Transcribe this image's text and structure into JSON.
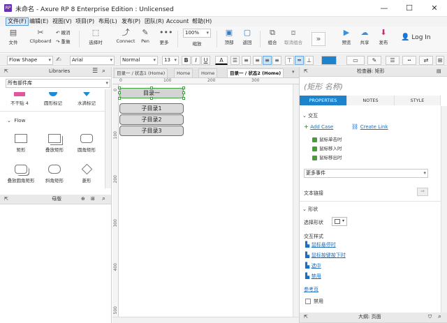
{
  "window": {
    "title": "未命名 - Axure RP 8 Enterprise Edition : Unlicensed",
    "app_icon_text": "RP",
    "minimize": "—",
    "maximize": "☐",
    "close": "✕"
  },
  "menus": [
    "文件(F)",
    "编辑(E)",
    "视图(V)",
    "项目(P)",
    "布局(L)",
    "发布(P)",
    "团队(R)",
    "Account",
    "帮助(H)"
  ],
  "toolbar": {
    "file": "文件",
    "clipboard": "Clipboard",
    "undo": "撤消",
    "redo": "重做",
    "select": "选择时",
    "connect": "Connect",
    "pen": "Pen",
    "more": "更多",
    "zoom_value": "100%",
    "zoom_label": "缩放",
    "top": "顶部",
    "back": "返回",
    "group": "组合",
    "ungroup": "取消组合",
    "preview": "预览",
    "share": "共享",
    "publish": "发布",
    "login": "Log In"
  },
  "format": {
    "style": "Flow Shape",
    "font": "Arial",
    "weight": "Normal",
    "size": "13",
    "bold": "B",
    "italic": "I",
    "underline": "U",
    "fontcolor": "A"
  },
  "left": {
    "libraries_title": "Libraries",
    "library_select": "所有部件库",
    "top_items": [
      "不干贴 4",
      "圆形标记",
      "水滴标记"
    ],
    "flow_section": "Flow",
    "flow_items": [
      "矩形",
      "叠放矩形",
      "圆角矩形",
      "叠放圆角矩形",
      "斜角矩形",
      "菱形"
    ],
    "masters_title": "母版"
  },
  "canvas": {
    "tabs": [
      "目录一 / 状态1 (Home)",
      "Home",
      "Home",
      "目录一 / 状态2 (Home)"
    ],
    "ruler_h": [
      "0",
      "100",
      "200",
      "300"
    ],
    "ruler_v": [
      "0",
      "100",
      "200",
      "300",
      "400",
      "500"
    ],
    "items": [
      "目录一",
      "子目录1",
      "子目录2",
      "子目录3"
    ]
  },
  "right": {
    "inspector_title": "检查器: 矩形",
    "shape_name_placeholder": "(矩形 名称)",
    "tabs": [
      "PROPERTIES",
      "NOTES",
      "STYLE"
    ],
    "interaction_section": "交互",
    "add_case": "Add Case",
    "create_link": "Create Link",
    "events": [
      "鼠标单击时",
      "鼠标移入时",
      "鼠标移出时"
    ],
    "more_events": "更多事件",
    "text_link": "文本链接",
    "shape_section": "形状",
    "select_shape": "选择形状",
    "interaction_styles": "交互样式",
    "styles": [
      "鼠标悬停时",
      "鼠标按键按下时",
      "选中",
      "禁用"
    ],
    "reference_page": "参考页",
    "disabled": "禁用",
    "footer": "大纲: 页面"
  },
  "colors": {
    "accent": "#1d83cc",
    "selection": "#3da13d",
    "link": "#1a6fc2"
  }
}
